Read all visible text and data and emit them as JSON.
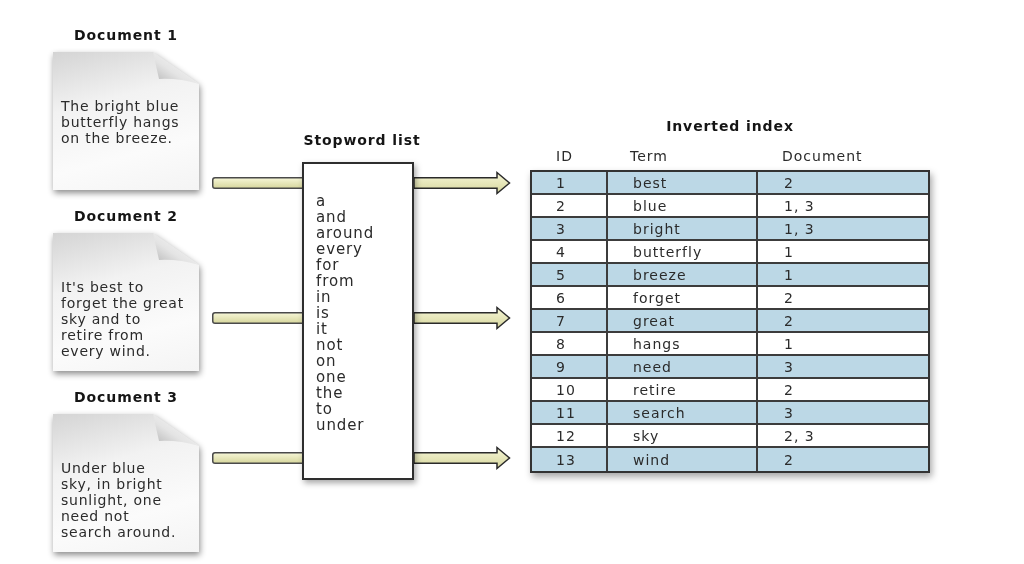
{
  "documents": [
    {
      "title": "Document 1",
      "lines": [
        "The bright blue",
        "butterfly hangs",
        "on the breeze."
      ]
    },
    {
      "title": "Document 2",
      "lines": [
        "It's best to",
        "forget the great",
        "sky and to",
        "retire from",
        "every wind."
      ]
    },
    {
      "title": "Document 3",
      "lines": [
        "Under blue",
        "sky, in bright",
        "sunlight, one",
        "need not",
        "search around."
      ]
    }
  ],
  "stopword_list": {
    "title": "Stopword list",
    "words": [
      "a",
      "and",
      "around",
      "every",
      "for",
      "from",
      "in",
      "is",
      "it",
      "not",
      "on",
      "one",
      "the",
      "to",
      "under"
    ]
  },
  "inverted_index": {
    "title": "Inverted index",
    "columns": [
      "ID",
      "Term",
      "Document"
    ],
    "rows": [
      [
        "1",
        "best",
        "2"
      ],
      [
        "2",
        "blue",
        "1, 3"
      ],
      [
        "3",
        "bright",
        "1, 3"
      ],
      [
        "4",
        "butterfly",
        "1"
      ],
      [
        "5",
        "breeze",
        "1"
      ],
      [
        "6",
        "forget",
        "2"
      ],
      [
        "7",
        "great",
        "2"
      ],
      [
        "8",
        "hangs",
        "1"
      ],
      [
        "9",
        "need",
        "3"
      ],
      [
        "10",
        "retire",
        "2"
      ],
      [
        "11",
        "search",
        "3"
      ],
      [
        "12",
        "sky",
        "2, 3"
      ],
      [
        "13",
        "wind",
        "2"
      ]
    ]
  }
}
